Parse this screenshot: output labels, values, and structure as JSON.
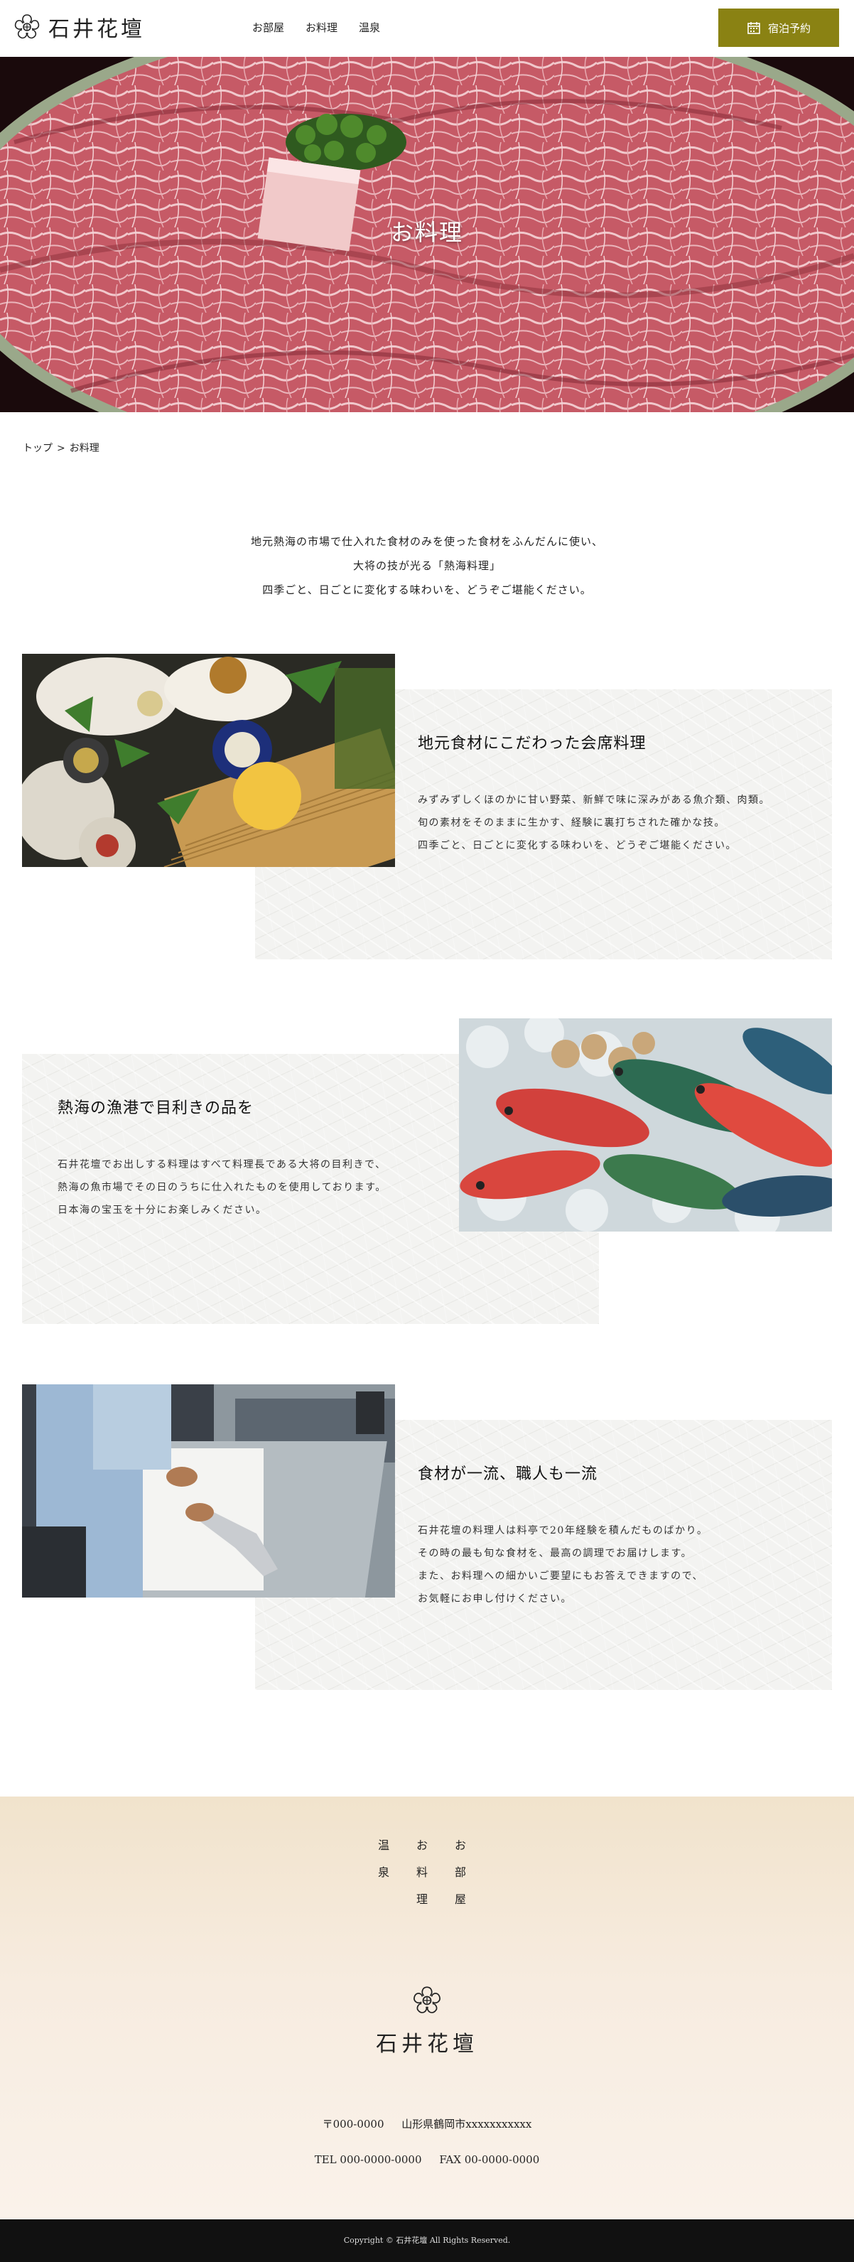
{
  "header": {
    "logo_text": "石井花壇",
    "nav": [
      "お部屋",
      "お料理",
      "温泉"
    ],
    "reserve_label": "宿泊予約"
  },
  "hero": {
    "title": "お料理"
  },
  "breadcrumb": {
    "home": "トップ",
    "separator": ">",
    "current": "お料理"
  },
  "intro": {
    "lines": [
      "地元熱海の市場で仕入れた食材のみを使った食材をふんだんに使い、",
      "大将の技が光る「熱海料理」",
      "四季ごと、日ごとに変化する味わいを、どうぞご堪能ください。"
    ]
  },
  "sections": [
    {
      "title": "地元食材にこだわった会席料理",
      "lines": [
        "みずみずしくほのかに甘い野菜、新鮮で味に深みがある魚介類、肉類。",
        "旬の素材をそのままに生かす、経験に裏打ちされた確かな技。",
        "四季ごと、日ごとに変化する味わいを、どうぞご堪能ください。"
      ]
    },
    {
      "title": "熱海の漁港で目利きの品を",
      "lines": [
        "石井花壇でお出しする料理はすべて料理長である大将の目利きで、",
        "熱海の魚市場でその日のうちに仕入れたものを使用しております。",
        "日本海の宝玉を十分にお楽しみください。"
      ]
    },
    {
      "title": "食材が一流、職人も一流",
      "lines": [
        "石井花壇の料理人は料亭で20年経験を積んだものばかり。",
        "その時の最も旬な食材を、最高の調理でお届けします。",
        "また、お料理への細かいご要望にもお答えできますので、",
        "お気軽にお申し付けください。"
      ]
    }
  ],
  "footer": {
    "nav": [
      [
        "温",
        "泉"
      ],
      [
        "お",
        "料",
        "理"
      ],
      [
        "お",
        "部",
        "屋"
      ]
    ],
    "logo_text": "石井花壇",
    "postal": "〒000-0000",
    "address": "山形県鶴岡市xxxxxxxxxxx",
    "tel": "TEL 000-0000-0000",
    "fax": "FAX 00-0000-0000",
    "copyright": "Copyright © 石井花壇 All Rights Reserved."
  },
  "colors": {
    "accent": "#8a8213",
    "footer_bg": "#f3e6d3",
    "copyright_bg": "#111111"
  }
}
